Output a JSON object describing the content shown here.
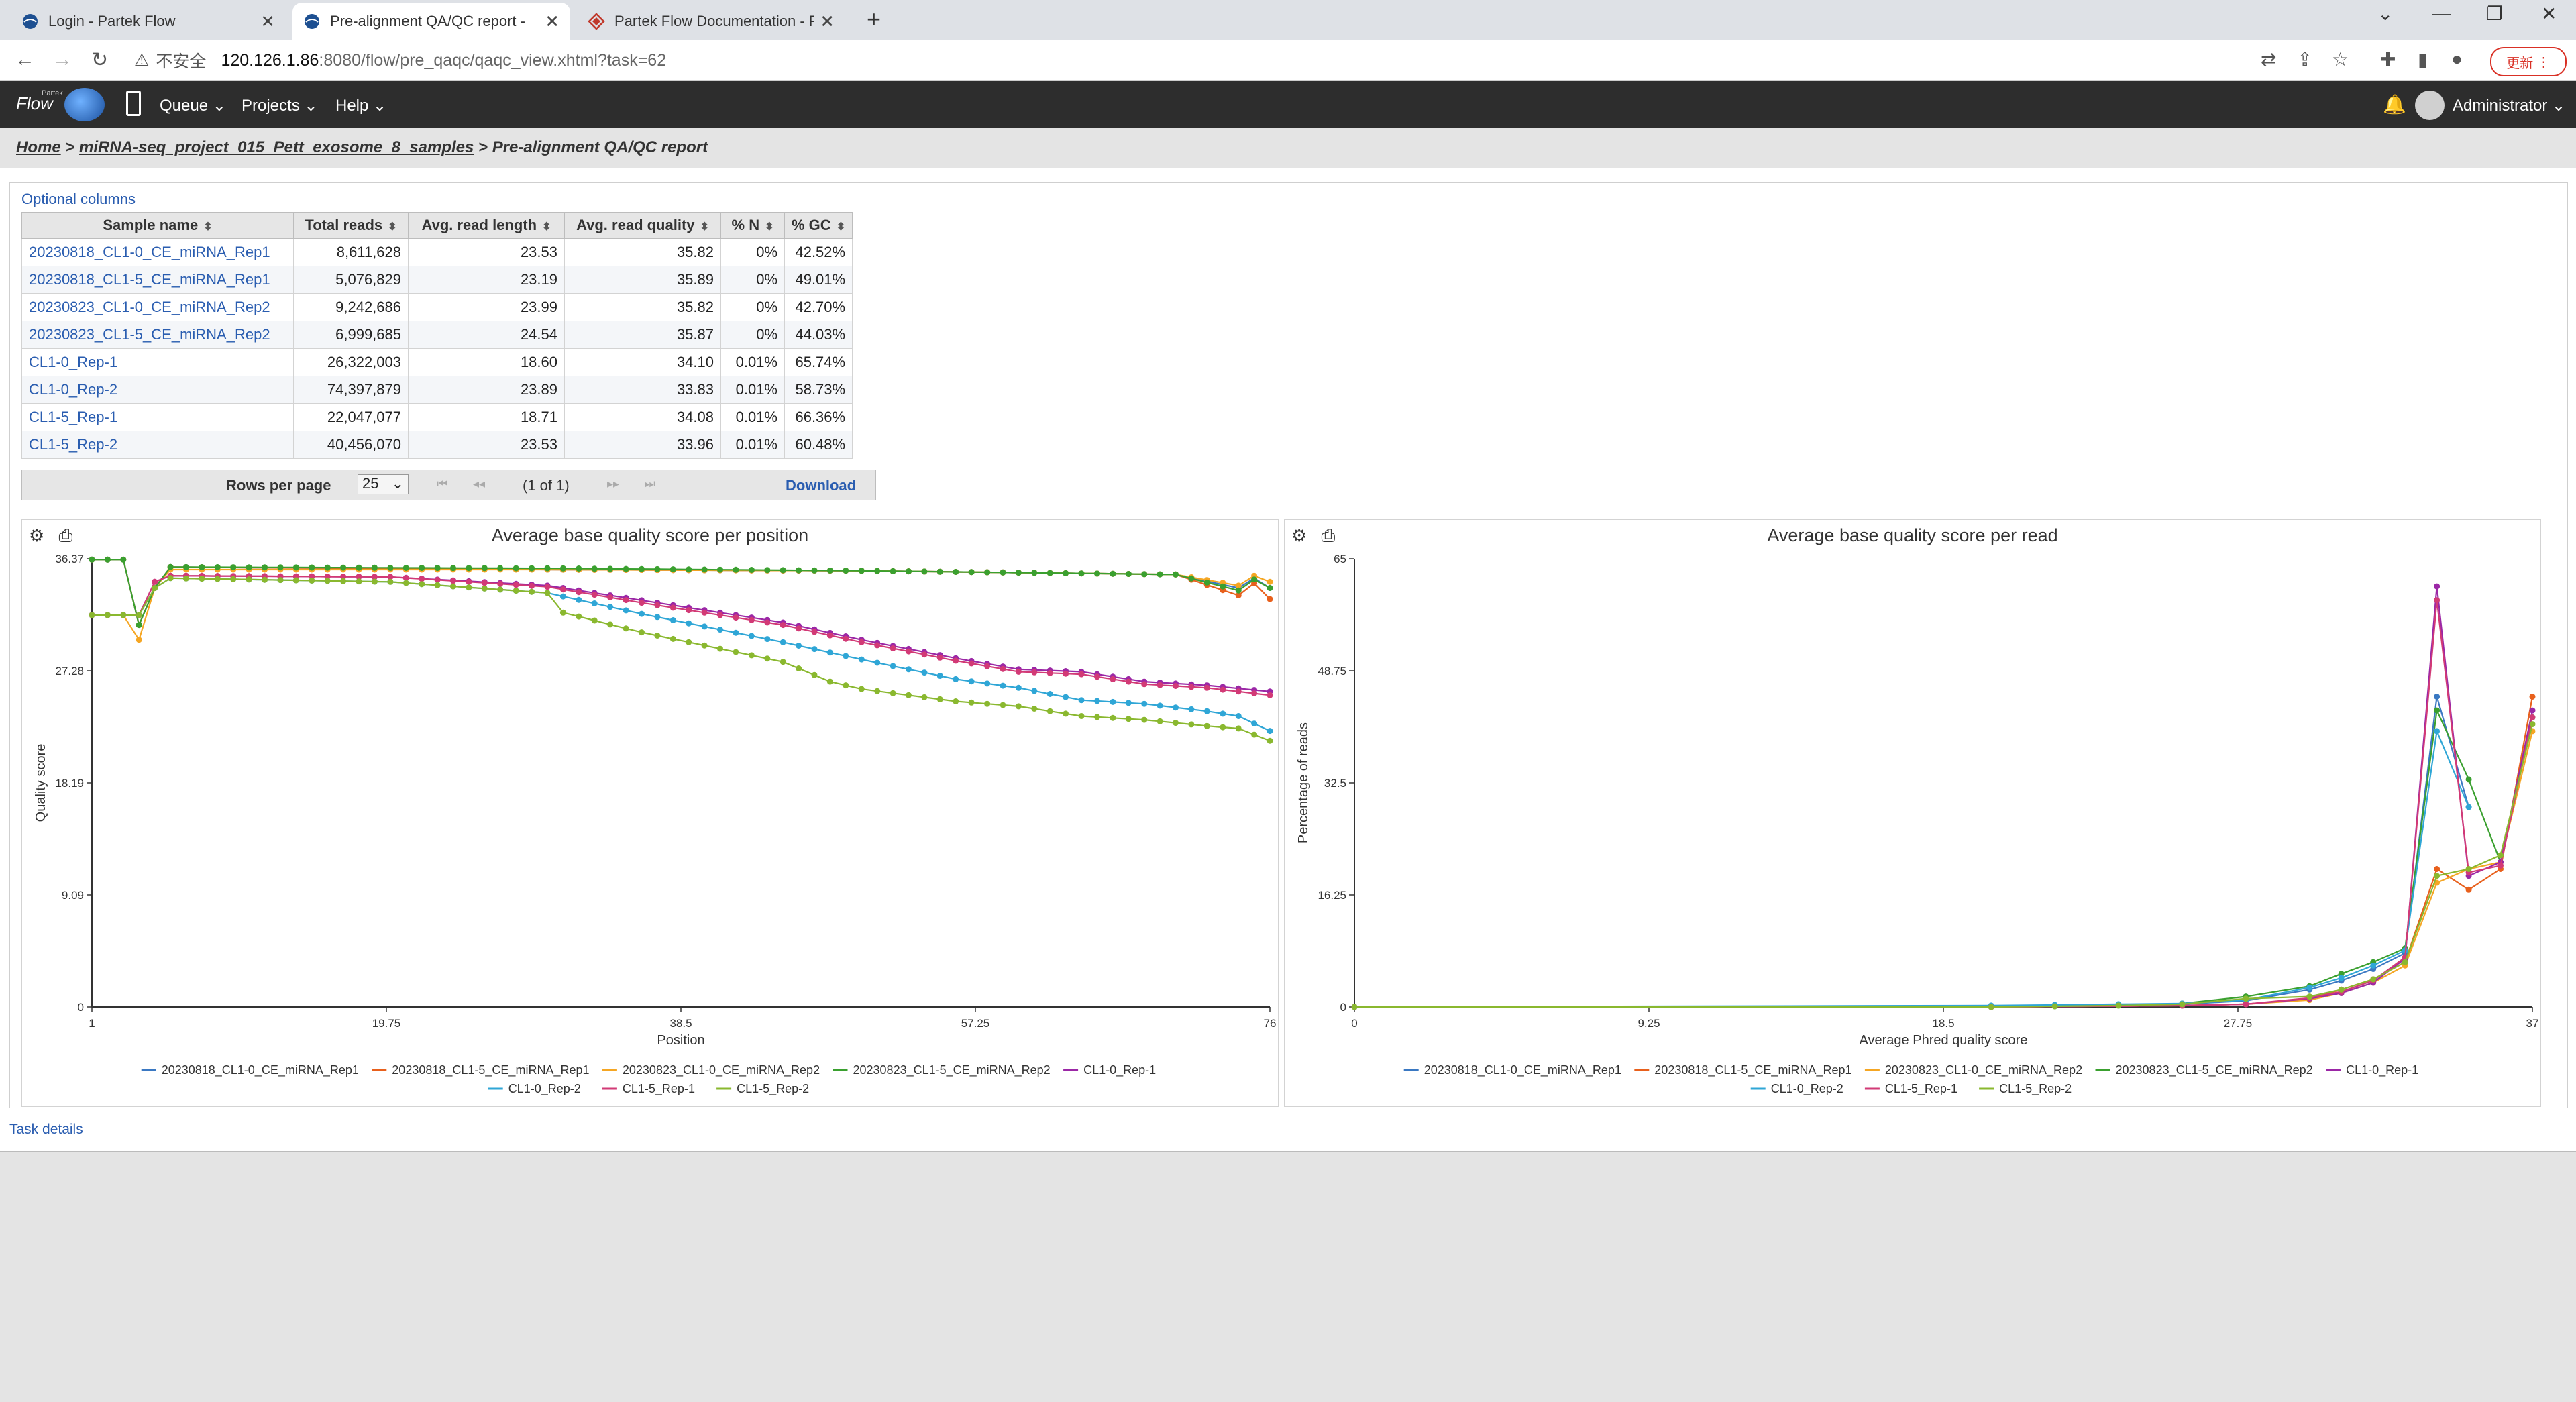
{
  "browser": {
    "tabs": [
      {
        "title": "Login - Partek Flow",
        "active": false
      },
      {
        "title": "Pre-alignment QA/QC report - ",
        "active": true
      },
      {
        "title": "Partek Flow Documentation - P",
        "active": false
      }
    ],
    "security_label": "不安全",
    "url_host": "120.126.1.86",
    "url_path": ":8080/flow/pre_qaqc/qaqc_view.xhtml?task=62",
    "update_label": "更新"
  },
  "app": {
    "logo_text": "Flow",
    "logo_sup": "Partek",
    "menus": [
      "Queue",
      "Projects",
      "Help"
    ],
    "user": "Administrator"
  },
  "breadcrumb": {
    "home": "Home",
    "project": "miRNA-seq_project_015_Pett_exosome_8_samples",
    "current": "Pre-alignment QA/QC report",
    "sep": " > "
  },
  "table": {
    "optional_columns": "Optional columns",
    "headers": [
      "Sample name",
      "Total reads",
      "Avg. read length",
      "Avg. read quality",
      "% N",
      "% GC"
    ],
    "rows": [
      [
        "20230818_CL1-0_CE_miRNA_Rep1",
        "8,611,628",
        "23.53",
        "35.82",
        "0%",
        "42.52%"
      ],
      [
        "20230818_CL1-5_CE_miRNA_Rep1",
        "5,076,829",
        "23.19",
        "35.89",
        "0%",
        "49.01%"
      ],
      [
        "20230823_CL1-0_CE_miRNA_Rep2",
        "9,242,686",
        "23.99",
        "35.82",
        "0%",
        "42.70%"
      ],
      [
        "20230823_CL1-5_CE_miRNA_Rep2",
        "6,999,685",
        "24.54",
        "35.87",
        "0%",
        "44.03%"
      ],
      [
        "CL1-0_Rep-1",
        "26,322,003",
        "18.60",
        "34.10",
        "0.01%",
        "65.74%"
      ],
      [
        "CL1-0_Rep-2",
        "74,397,879",
        "23.89",
        "33.83",
        "0.01%",
        "58.73%"
      ],
      [
        "CL1-5_Rep-1",
        "22,047,077",
        "18.71",
        "34.08",
        "0.01%",
        "66.36%"
      ],
      [
        "CL1-5_Rep-2",
        "40,456,070",
        "23.53",
        "33.96",
        "0.01%",
        "60.48%"
      ]
    ],
    "rows_per_page_label": "Rows per page",
    "rows_per_page_value": "25",
    "page_info": "(1 of 1)",
    "download_label": "Download"
  },
  "task_details": "Task details",
  "chart_data": [
    {
      "type": "line",
      "title": "Average base quality score per position",
      "xlabel": "Position",
      "ylabel": "Quality score",
      "xlim": [
        1,
        76
      ],
      "ylim": [
        0,
        36.37
      ],
      "x_ticks": [
        "1",
        "19.75",
        "38.5",
        "57.25",
        "76"
      ],
      "y_ticks": [
        "0",
        "9.09",
        "18.19",
        "27.28",
        "36.37"
      ],
      "legend": "bottom",
      "series": [
        {
          "name": "20230818_CL1-0_CE_miRNA_Rep1",
          "color": "#3a78c2",
          "anchors": [
            [
              1,
              36.3
            ],
            [
              2,
              36.3
            ],
            [
              3,
              36.3
            ],
            [
              4,
              31.0
            ],
            [
              5,
              34.0
            ],
            [
              6,
              35.7
            ],
            [
              30,
              35.5
            ],
            [
              50,
              35.4
            ],
            [
              70,
              35.1
            ],
            [
              74,
              34.0
            ],
            [
              75,
              34.8
            ],
            [
              76,
              34.0
            ]
          ]
        },
        {
          "name": "20230818_CL1-5_CE_miRNA_Rep1",
          "color": "#e8601c",
          "anchors": [
            [
              1,
              36.3
            ],
            [
              2,
              36.3
            ],
            [
              3,
              36.3
            ],
            [
              4,
              31.0
            ],
            [
              5,
              34.0
            ],
            [
              6,
              35.7
            ],
            [
              30,
              35.5
            ],
            [
              50,
              35.4
            ],
            [
              70,
              35.1
            ],
            [
              74,
              33.4
            ],
            [
              75,
              34.4
            ],
            [
              76,
              33.1
            ]
          ]
        },
        {
          "name": "20230823_CL1-0_CE_miRNA_Rep2",
          "color": "#f5a623",
          "anchors": [
            [
              1,
              31.8
            ],
            [
              2,
              31.8
            ],
            [
              3,
              31.8
            ],
            [
              4,
              29.8
            ],
            [
              5,
              34.0
            ],
            [
              6,
              35.5
            ],
            [
              30,
              35.5
            ],
            [
              50,
              35.4
            ],
            [
              70,
              35.1
            ],
            [
              74,
              34.2
            ],
            [
              75,
              35.0
            ],
            [
              76,
              34.5
            ]
          ]
        },
        {
          "name": "20230823_CL1-5_CE_miRNA_Rep2",
          "color": "#3aa02f",
          "anchors": [
            [
              1,
              36.3
            ],
            [
              2,
              36.3
            ],
            [
              3,
              36.3
            ],
            [
              4,
              31.0
            ],
            [
              5,
              34.0
            ],
            [
              6,
              35.7
            ],
            [
              30,
              35.6
            ],
            [
              50,
              35.4
            ],
            [
              70,
              35.1
            ],
            [
              74,
              33.8
            ],
            [
              75,
              34.7
            ],
            [
              76,
              34.0
            ]
          ]
        },
        {
          "name": "CL1-0_Rep-1",
          "color": "#9b27a6",
          "anchors": [
            [
              1,
              31.8
            ],
            [
              4,
              31.8
            ],
            [
              5,
              34.5
            ],
            [
              6,
              35.0
            ],
            [
              20,
              34.9
            ],
            [
              30,
              34.2
            ],
            [
              36,
              33.0
            ],
            [
              45,
              31.2
            ],
            [
              50,
              29.8
            ],
            [
              56,
              28.3
            ],
            [
              60,
              27.4
            ],
            [
              64,
              27.2
            ],
            [
              68,
              26.4
            ],
            [
              72,
              26.1
            ],
            [
              76,
              25.6
            ]
          ]
        },
        {
          "name": "CL1-0_Rep-2",
          "color": "#2fa6d6",
          "anchors": [
            [
              1,
              31.8
            ],
            [
              4,
              31.8
            ],
            [
              5,
              34.0
            ],
            [
              6,
              34.8
            ],
            [
              20,
              34.5
            ],
            [
              30,
              33.6
            ],
            [
              36,
              31.9
            ],
            [
              45,
              29.6
            ],
            [
              50,
              28.2
            ],
            [
              56,
              26.6
            ],
            [
              60,
              25.9
            ],
            [
              64,
              24.9
            ],
            [
              68,
              24.6
            ],
            [
              72,
              24.0
            ],
            [
              74,
              23.6
            ],
            [
              76,
              22.4
            ]
          ]
        },
        {
          "name": "CL1-5_Rep-1",
          "color": "#d23a76",
          "anchors": [
            [
              1,
              31.8
            ],
            [
              4,
              31.8
            ],
            [
              5,
              34.5
            ],
            [
              6,
              35.0
            ],
            [
              20,
              34.9
            ],
            [
              30,
              34.1
            ],
            [
              36,
              32.8
            ],
            [
              45,
              31.0
            ],
            [
              50,
              29.6
            ],
            [
              56,
              28.1
            ],
            [
              60,
              27.2
            ],
            [
              64,
              27.0
            ],
            [
              68,
              26.2
            ],
            [
              72,
              25.9
            ],
            [
              76,
              25.3
            ]
          ]
        },
        {
          "name": "CL1-5_Rep-2",
          "color": "#8ab82f",
          "anchors": [
            [
              1,
              31.8
            ],
            [
              4,
              31.8
            ],
            [
              5,
              34.0
            ],
            [
              6,
              34.8
            ],
            [
              20,
              34.5
            ],
            [
              30,
              33.6
            ],
            [
              31,
              32.0
            ],
            [
              36,
              30.4
            ],
            [
              45,
              28.0
            ],
            [
              48,
              26.4
            ],
            [
              50,
              25.8
            ],
            [
              56,
              24.8
            ],
            [
              60,
              24.4
            ],
            [
              64,
              23.6
            ],
            [
              68,
              23.3
            ],
            [
              72,
              22.8
            ],
            [
              74,
              22.6
            ],
            [
              76,
              21.6
            ]
          ]
        }
      ]
    },
    {
      "type": "line",
      "title": "Average base quality score per read",
      "xlabel": "Average Phred quality score",
      "ylabel": "Percentage of reads",
      "xlim": [
        0,
        37
      ],
      "ylim": [
        0,
        65
      ],
      "x_ticks": [
        "0",
        "9.25",
        "18.5",
        "27.75",
        "37"
      ],
      "y_ticks": [
        "0",
        "16.25",
        "32.5",
        "48.75",
        "65"
      ],
      "legend": "bottom",
      "series": [
        {
          "name": "20230818_CL1-0_CE_miRNA_Rep1",
          "color": "#3a78c2",
          "points": [
            [
              0,
              0
            ],
            [
              20,
              0.1
            ],
            [
              22,
              0.2
            ],
            [
              24,
              0.3
            ],
            [
              26,
              0.4
            ],
            [
              28,
              0.9
            ],
            [
              30,
              2.5
            ],
            [
              31,
              3.8
            ],
            [
              32,
              5.5
            ],
            [
              33,
              7.8
            ],
            [
              34,
              45.0
            ],
            [
              35,
              29.0
            ]
          ]
        },
        {
          "name": "20230818_CL1-5_CE_miRNA_Rep1",
          "color": "#e8601c",
          "points": [
            [
              0,
              0
            ],
            [
              20,
              0
            ],
            [
              26,
              0.2
            ],
            [
              28,
              0.4
            ],
            [
              30,
              1.2
            ],
            [
              31,
              2.5
            ],
            [
              32,
              4.0
            ],
            [
              33,
              6.5
            ],
            [
              34,
              20.0
            ],
            [
              35,
              17.0
            ],
            [
              36,
              20.0
            ],
            [
              37,
              45.0
            ]
          ]
        },
        {
          "name": "20230823_CL1-0_CE_miRNA_Rep2",
          "color": "#f5a623",
          "points": [
            [
              0,
              0
            ],
            [
              20,
              0
            ],
            [
              26,
              0.2
            ],
            [
              28,
              0.4
            ],
            [
              30,
              1.0
            ],
            [
              31,
              2.0
            ],
            [
              32,
              3.5
            ],
            [
              33,
              6.0
            ],
            [
              34,
              18.0
            ],
            [
              35,
              20.0
            ],
            [
              36,
              21.0
            ],
            [
              37,
              40.0
            ]
          ]
        },
        {
          "name": "20230823_CL1-5_CE_miRNA_Rep2",
          "color": "#3aa02f",
          "points": [
            [
              0,
              0
            ],
            [
              20,
              0
            ],
            [
              22,
              0.1
            ],
            [
              24,
              0.2
            ],
            [
              26,
              0.5
            ],
            [
              28,
              1.5
            ],
            [
              30,
              3.0
            ],
            [
              31,
              4.8
            ],
            [
              32,
              6.5
            ],
            [
              33,
              8.5
            ],
            [
              34,
              43.0
            ],
            [
              35,
              33.0
            ],
            [
              36,
              21.0
            ],
            [
              37,
              42.0
            ]
          ]
        },
        {
          "name": "CL1-0_Rep-1",
          "color": "#9b27a6",
          "points": [
            [
              0,
              0
            ],
            [
              20,
              0
            ],
            [
              26,
              0.2
            ],
            [
              28,
              0.4
            ],
            [
              30,
              1.2
            ],
            [
              31,
              2.0
            ],
            [
              32,
              3.5
            ],
            [
              33,
              7.0
            ],
            [
              34,
              61.0
            ],
            [
              35,
              19.0
            ],
            [
              36,
              21.0
            ],
            [
              37,
              43.0
            ]
          ]
        },
        {
          "name": "CL1-0_Rep-2",
          "color": "#2fa6d6",
          "points": [
            [
              0,
              0
            ],
            [
              20,
              0.2
            ],
            [
              22,
              0.3
            ],
            [
              24,
              0.4
            ],
            [
              26,
              0.5
            ],
            [
              28,
              1.0
            ],
            [
              30,
              2.8
            ],
            [
              31,
              4.2
            ],
            [
              32,
              6.0
            ],
            [
              33,
              8.2
            ],
            [
              34,
              40.0
            ],
            [
              35,
              29.0
            ]
          ]
        },
        {
          "name": "CL1-5_Rep-1",
          "color": "#d23a76",
          "points": [
            [
              0,
              0
            ],
            [
              20,
              0
            ],
            [
              26,
              0.2
            ],
            [
              28,
              0.4
            ],
            [
              30,
              1.3
            ],
            [
              31,
              2.2
            ],
            [
              32,
              3.8
            ],
            [
              33,
              7.2
            ],
            [
              34,
              59.0
            ],
            [
              35,
              19.5
            ],
            [
              36,
              20.5
            ],
            [
              37,
              42.0
            ]
          ]
        },
        {
          "name": "CL1-5_Rep-2",
          "color": "#8ab82f",
          "points": [
            [
              0,
              0
            ],
            [
              20,
              0
            ],
            [
              22,
              0.1
            ],
            [
              24,
              0.2
            ],
            [
              26,
              0.4
            ],
            [
              28,
              1.2
            ],
            [
              30,
              1.5
            ],
            [
              31,
              2.5
            ],
            [
              32,
              4.0
            ],
            [
              33,
              6.5
            ],
            [
              34,
              19.0
            ],
            [
              35,
              20.0
            ],
            [
              36,
              22.0
            ],
            [
              37,
              41.0
            ]
          ]
        }
      ]
    }
  ]
}
